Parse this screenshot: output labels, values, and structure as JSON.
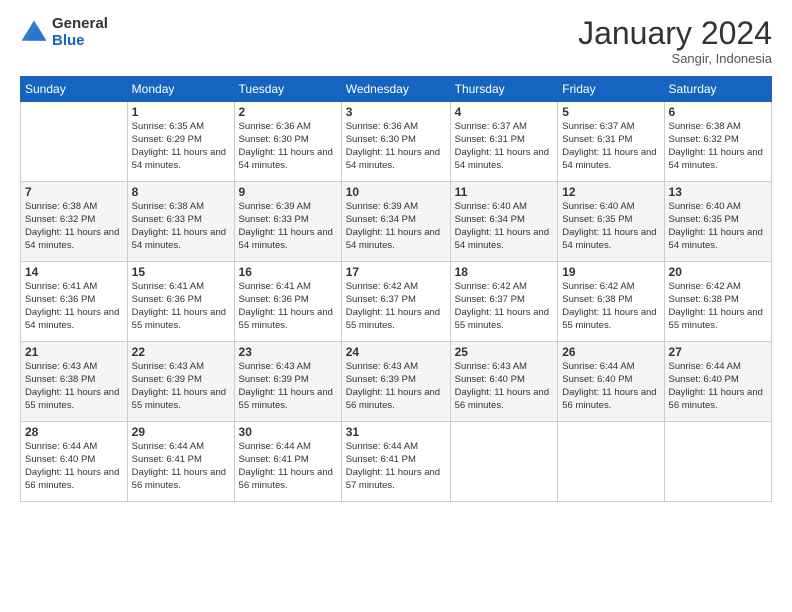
{
  "header": {
    "logo_general": "General",
    "logo_blue": "Blue",
    "month_title": "January 2024",
    "subtitle": "Sangir, Indonesia"
  },
  "days_of_week": [
    "Sunday",
    "Monday",
    "Tuesday",
    "Wednesday",
    "Thursday",
    "Friday",
    "Saturday"
  ],
  "weeks": [
    [
      {
        "day": "",
        "sunrise": "",
        "sunset": "",
        "daylight": ""
      },
      {
        "day": "1",
        "sunrise": "Sunrise: 6:35 AM",
        "sunset": "Sunset: 6:29 PM",
        "daylight": "Daylight: 11 hours and 54 minutes."
      },
      {
        "day": "2",
        "sunrise": "Sunrise: 6:36 AM",
        "sunset": "Sunset: 6:30 PM",
        "daylight": "Daylight: 11 hours and 54 minutes."
      },
      {
        "day": "3",
        "sunrise": "Sunrise: 6:36 AM",
        "sunset": "Sunset: 6:30 PM",
        "daylight": "Daylight: 11 hours and 54 minutes."
      },
      {
        "day": "4",
        "sunrise": "Sunrise: 6:37 AM",
        "sunset": "Sunset: 6:31 PM",
        "daylight": "Daylight: 11 hours and 54 minutes."
      },
      {
        "day": "5",
        "sunrise": "Sunrise: 6:37 AM",
        "sunset": "Sunset: 6:31 PM",
        "daylight": "Daylight: 11 hours and 54 minutes."
      },
      {
        "day": "6",
        "sunrise": "Sunrise: 6:38 AM",
        "sunset": "Sunset: 6:32 PM",
        "daylight": "Daylight: 11 hours and 54 minutes."
      }
    ],
    [
      {
        "day": "7",
        "sunrise": "Sunrise: 6:38 AM",
        "sunset": "Sunset: 6:32 PM",
        "daylight": "Daylight: 11 hours and 54 minutes."
      },
      {
        "day": "8",
        "sunrise": "Sunrise: 6:38 AM",
        "sunset": "Sunset: 6:33 PM",
        "daylight": "Daylight: 11 hours and 54 minutes."
      },
      {
        "day": "9",
        "sunrise": "Sunrise: 6:39 AM",
        "sunset": "Sunset: 6:33 PM",
        "daylight": "Daylight: 11 hours and 54 minutes."
      },
      {
        "day": "10",
        "sunrise": "Sunrise: 6:39 AM",
        "sunset": "Sunset: 6:34 PM",
        "daylight": "Daylight: 11 hours and 54 minutes."
      },
      {
        "day": "11",
        "sunrise": "Sunrise: 6:40 AM",
        "sunset": "Sunset: 6:34 PM",
        "daylight": "Daylight: 11 hours and 54 minutes."
      },
      {
        "day": "12",
        "sunrise": "Sunrise: 6:40 AM",
        "sunset": "Sunset: 6:35 PM",
        "daylight": "Daylight: 11 hours and 54 minutes."
      },
      {
        "day": "13",
        "sunrise": "Sunrise: 6:40 AM",
        "sunset": "Sunset: 6:35 PM",
        "daylight": "Daylight: 11 hours and 54 minutes."
      }
    ],
    [
      {
        "day": "14",
        "sunrise": "Sunrise: 6:41 AM",
        "sunset": "Sunset: 6:36 PM",
        "daylight": "Daylight: 11 hours and 54 minutes."
      },
      {
        "day": "15",
        "sunrise": "Sunrise: 6:41 AM",
        "sunset": "Sunset: 6:36 PM",
        "daylight": "Daylight: 11 hours and 55 minutes."
      },
      {
        "day": "16",
        "sunrise": "Sunrise: 6:41 AM",
        "sunset": "Sunset: 6:36 PM",
        "daylight": "Daylight: 11 hours and 55 minutes."
      },
      {
        "day": "17",
        "sunrise": "Sunrise: 6:42 AM",
        "sunset": "Sunset: 6:37 PM",
        "daylight": "Daylight: 11 hours and 55 minutes."
      },
      {
        "day": "18",
        "sunrise": "Sunrise: 6:42 AM",
        "sunset": "Sunset: 6:37 PM",
        "daylight": "Daylight: 11 hours and 55 minutes."
      },
      {
        "day": "19",
        "sunrise": "Sunrise: 6:42 AM",
        "sunset": "Sunset: 6:38 PM",
        "daylight": "Daylight: 11 hours and 55 minutes."
      },
      {
        "day": "20",
        "sunrise": "Sunrise: 6:42 AM",
        "sunset": "Sunset: 6:38 PM",
        "daylight": "Daylight: 11 hours and 55 minutes."
      }
    ],
    [
      {
        "day": "21",
        "sunrise": "Sunrise: 6:43 AM",
        "sunset": "Sunset: 6:38 PM",
        "daylight": "Daylight: 11 hours and 55 minutes."
      },
      {
        "day": "22",
        "sunrise": "Sunrise: 6:43 AM",
        "sunset": "Sunset: 6:39 PM",
        "daylight": "Daylight: 11 hours and 55 minutes."
      },
      {
        "day": "23",
        "sunrise": "Sunrise: 6:43 AM",
        "sunset": "Sunset: 6:39 PM",
        "daylight": "Daylight: 11 hours and 55 minutes."
      },
      {
        "day": "24",
        "sunrise": "Sunrise: 6:43 AM",
        "sunset": "Sunset: 6:39 PM",
        "daylight": "Daylight: 11 hours and 56 minutes."
      },
      {
        "day": "25",
        "sunrise": "Sunrise: 6:43 AM",
        "sunset": "Sunset: 6:40 PM",
        "daylight": "Daylight: 11 hours and 56 minutes."
      },
      {
        "day": "26",
        "sunrise": "Sunrise: 6:44 AM",
        "sunset": "Sunset: 6:40 PM",
        "daylight": "Daylight: 11 hours and 56 minutes."
      },
      {
        "day": "27",
        "sunrise": "Sunrise: 6:44 AM",
        "sunset": "Sunset: 6:40 PM",
        "daylight": "Daylight: 11 hours and 56 minutes."
      }
    ],
    [
      {
        "day": "28",
        "sunrise": "Sunrise: 6:44 AM",
        "sunset": "Sunset: 6:40 PM",
        "daylight": "Daylight: 11 hours and 56 minutes."
      },
      {
        "day": "29",
        "sunrise": "Sunrise: 6:44 AM",
        "sunset": "Sunset: 6:41 PM",
        "daylight": "Daylight: 11 hours and 56 minutes."
      },
      {
        "day": "30",
        "sunrise": "Sunrise: 6:44 AM",
        "sunset": "Sunset: 6:41 PM",
        "daylight": "Daylight: 11 hours and 56 minutes."
      },
      {
        "day": "31",
        "sunrise": "Sunrise: 6:44 AM",
        "sunset": "Sunset: 6:41 PM",
        "daylight": "Daylight: 11 hours and 57 minutes."
      },
      {
        "day": "",
        "sunrise": "",
        "sunset": "",
        "daylight": ""
      },
      {
        "day": "",
        "sunrise": "",
        "sunset": "",
        "daylight": ""
      },
      {
        "day": "",
        "sunrise": "",
        "sunset": "",
        "daylight": ""
      }
    ]
  ]
}
